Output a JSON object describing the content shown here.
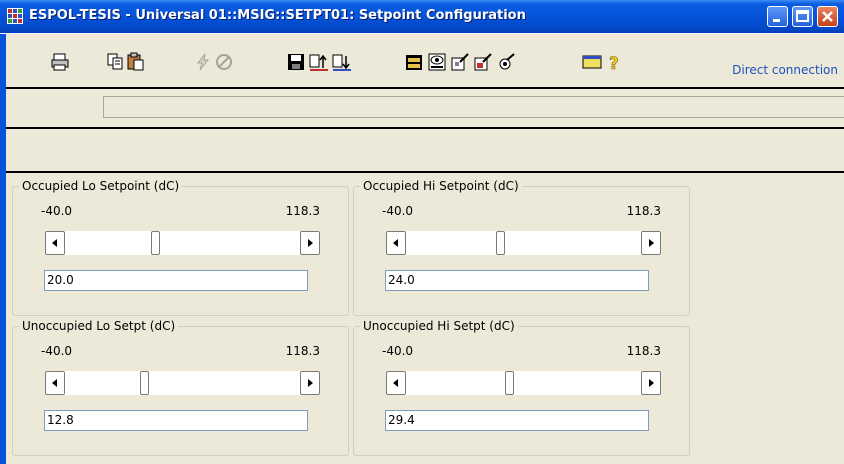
{
  "window": {
    "title": "ESPOL-TESIS - Universal 01::MSIG::SETPT01: Setpoint Configuration",
    "colors": {
      "titlebar": "#0553D9",
      "face": "#ECE9D8",
      "link": "#2050C0"
    }
  },
  "toolbar": {
    "buttons": [
      {
        "name": "print-icon"
      },
      {
        "name": "copy-icon"
      },
      {
        "name": "paste-icon"
      },
      {
        "name": "lightning-icon"
      },
      {
        "name": "no-icon"
      },
      {
        "name": "save-icon"
      },
      {
        "name": "upload-icon"
      },
      {
        "name": "download-icon"
      },
      {
        "name": "folder-icon"
      },
      {
        "name": "eye-icon"
      },
      {
        "name": "wizard-icon"
      },
      {
        "name": "wizard2-icon"
      },
      {
        "name": "tools-icon"
      },
      {
        "name": "window-icon"
      },
      {
        "name": "help-icon"
      }
    ],
    "connection": "Direct connection"
  },
  "groups": [
    {
      "label": "Occupied Lo Setpoint  (dC)",
      "min": "-40.0",
      "max": "118.3",
      "value": "20.0",
      "level": 0.38
    },
    {
      "label": "Occupied Hi Setpoint  (dC)",
      "min": "-40.0",
      "max": "118.3",
      "value": "24.0",
      "level": 0.4
    },
    {
      "label": "Unoccupied Lo Setpt  (dC)",
      "min": "-40.0",
      "max": "118.3",
      "value": "12.8",
      "level": 0.33
    },
    {
      "label": "Unoccupied Hi Setpt  (dC)",
      "min": "-40.0",
      "max": "118.3",
      "value": "29.4",
      "level": 0.44
    }
  ]
}
